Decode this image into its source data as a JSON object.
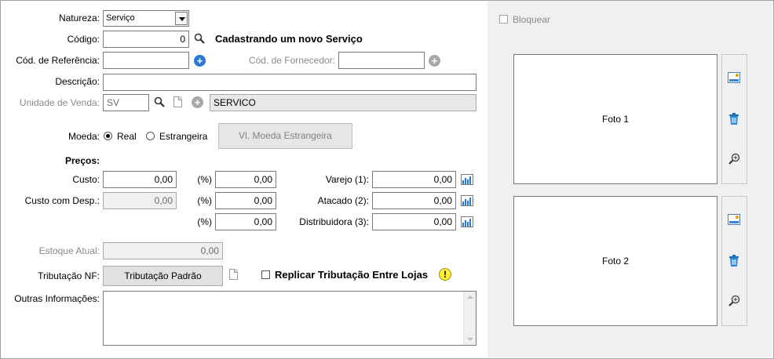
{
  "form": {
    "natureza": {
      "label": "Natureza:",
      "value": "Serviço"
    },
    "codigo": {
      "label": "Código:",
      "value": "0",
      "status": "Cadastrando um novo Serviço"
    },
    "cod_referencia": {
      "label": "Cód. de Referência:",
      "value": ""
    },
    "cod_fornecedor": {
      "label": "Cód. de Fornecedor:",
      "value": ""
    },
    "descricao": {
      "label": "Descrição:",
      "value": ""
    },
    "unidade_venda": {
      "label": "Unidade de Venda:",
      "code": "SV",
      "description": "SERVICO"
    },
    "moeda": {
      "label": "Moeda:",
      "options": [
        "Real",
        "Estrangeira"
      ],
      "selected": "Real",
      "button": "Vl. Moeda Estrangeira"
    },
    "precos": {
      "title": "Preços:",
      "custo": {
        "label": "Custo:",
        "value": "0,00"
      },
      "custo_desp": {
        "label": "Custo com Desp.:",
        "value": "0,00"
      },
      "percent_label": "(%)",
      "percents": [
        "0,00",
        "0,00",
        "0,00"
      ],
      "varejo": {
        "label": "Varejo (1):",
        "value": "0,00"
      },
      "atacado": {
        "label": "Atacado (2):",
        "value": "0,00"
      },
      "distribuidora": {
        "label": "Distribuidora (3):",
        "value": "0,00"
      }
    },
    "estoque": {
      "label": "Estoque Atual:",
      "value": "0,00"
    },
    "tributacao": {
      "label": "Tributação NF:",
      "button": "Tributação Padrão",
      "replicar_label": "Replicar Tributação Entre Lojas"
    },
    "outras": {
      "label": "Outras Informações:",
      "value": ""
    }
  },
  "right_panel": {
    "bloquear_label": "Bloquear",
    "photo1": "Foto 1",
    "photo2": "Foto 2"
  },
  "colors": {
    "accent_blue": "#2a78d6",
    "panel_bg": "#f0f0f0",
    "disabled_text": "#8a8a8a",
    "warning_yellow": "#ffef3a"
  }
}
